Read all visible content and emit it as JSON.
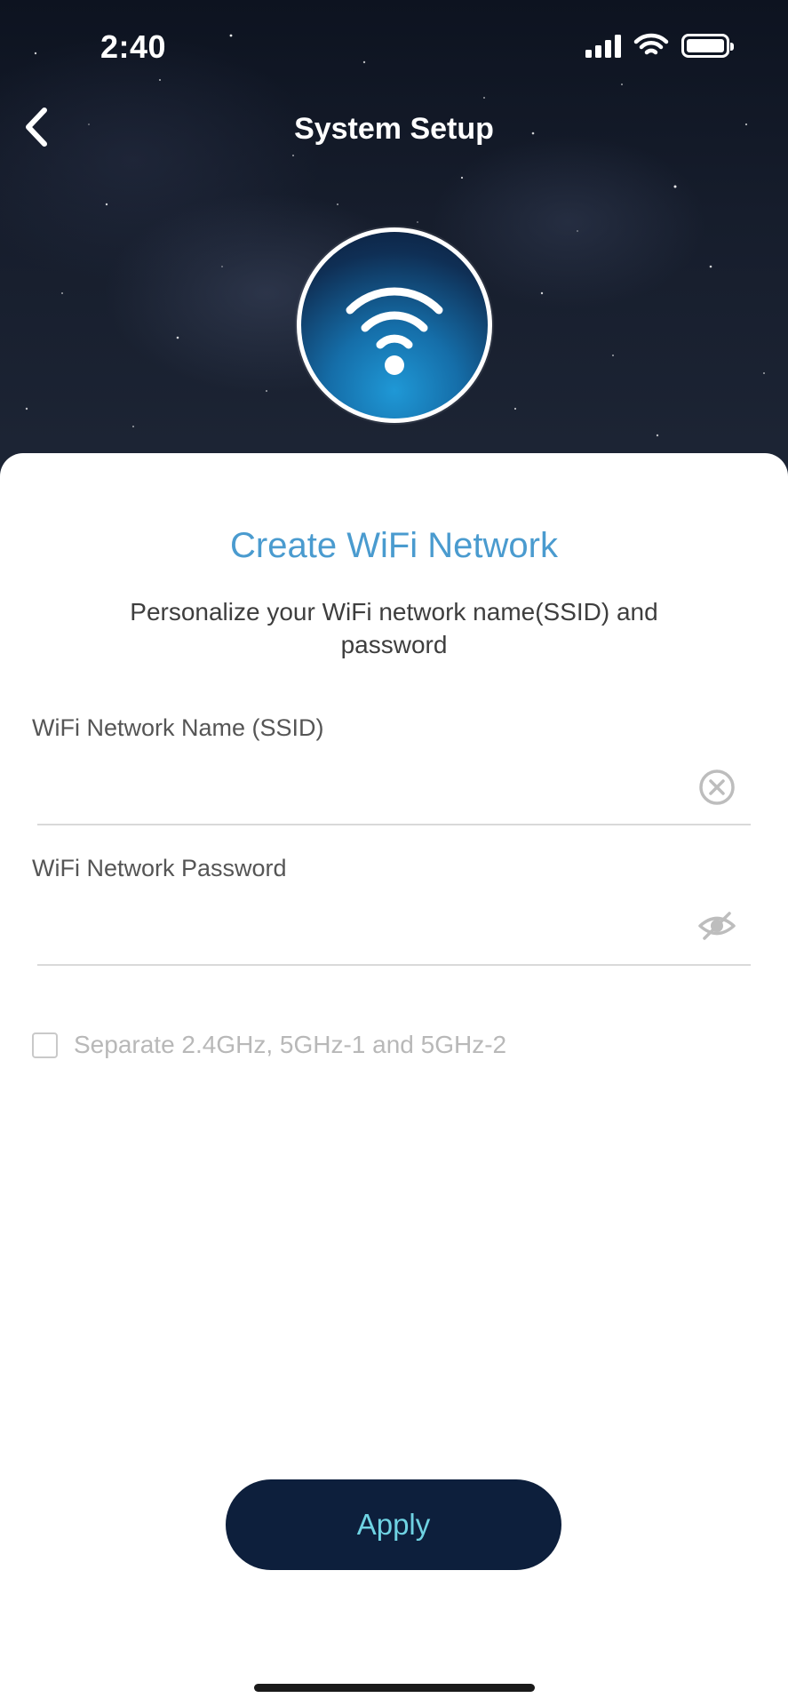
{
  "status_bar": {
    "time": "2:40",
    "signal_icon": "cellular-signal-icon",
    "wifi_icon": "wifi-icon",
    "battery_icon": "battery-icon"
  },
  "nav": {
    "back_icon": "chevron-left-icon",
    "title": "System Setup"
  },
  "hero": {
    "badge_icon": "wifi-icon",
    "badge_color": "#1f98d6"
  },
  "form": {
    "title": "Create WiFi Network",
    "subtitle": "Personalize your WiFi network name(SSID) and password",
    "ssid": {
      "label": "WiFi Network Name (SSID)",
      "value": "",
      "clear_icon": "clear-circle-icon"
    },
    "password": {
      "label": "WiFi Network Password",
      "value": "",
      "visibility_icon": "eye-off-icon"
    },
    "separate_bands": {
      "label": "Separate 2.4GHz, 5GHz-1 and 5GHz-2",
      "checked": false
    },
    "apply_label": "Apply"
  },
  "colors": {
    "accent": "#4a9bcf",
    "button_bg": "#0d1f3c",
    "button_text": "#6fd3e3"
  }
}
